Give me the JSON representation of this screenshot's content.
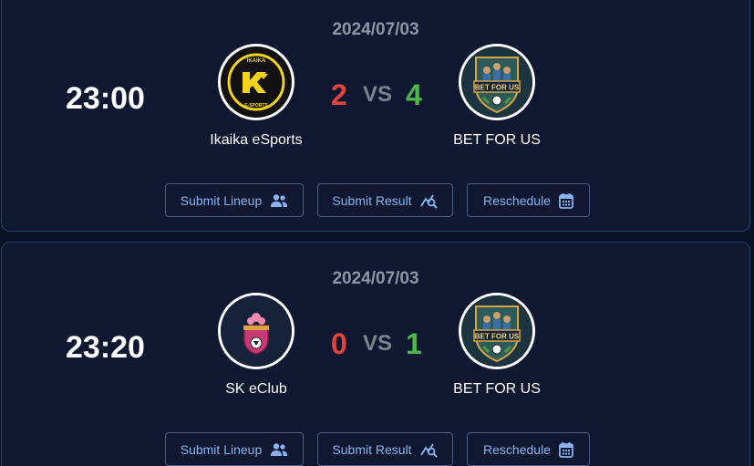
{
  "matches": [
    {
      "date": "2024/07/03",
      "time": "23:00",
      "home": {
        "name": "Ikaika eSports",
        "score": "2",
        "logo_text": "IKAIKA",
        "logo_sub": "E-SPORTS"
      },
      "vs": "VS",
      "away": {
        "name": "BET FOR US",
        "score": "4",
        "logo_text": "BET FOR US"
      },
      "actions": {
        "lineup": "Submit Lineup",
        "result": "Submit Result",
        "reschedule": "Reschedule"
      }
    },
    {
      "date": "2024/07/03",
      "time": "23:20",
      "home": {
        "name": "SK eClub",
        "score": "0"
      },
      "vs": "VS",
      "away": {
        "name": "BET FOR US",
        "score": "1",
        "logo_text": "BET FOR US"
      },
      "actions": {
        "lineup": "Submit Lineup",
        "result": "Submit Result",
        "reschedule": "Reschedule"
      }
    }
  ],
  "colors": {
    "background": "#0a1226",
    "card": "#0f1830",
    "home_score": "#e0453c",
    "away_score": "#4fb84a",
    "button_text": "#8ab4f0"
  },
  "icons": {
    "lineup": "users-icon",
    "result": "chart-search-icon",
    "reschedule": "calendar-icon"
  }
}
